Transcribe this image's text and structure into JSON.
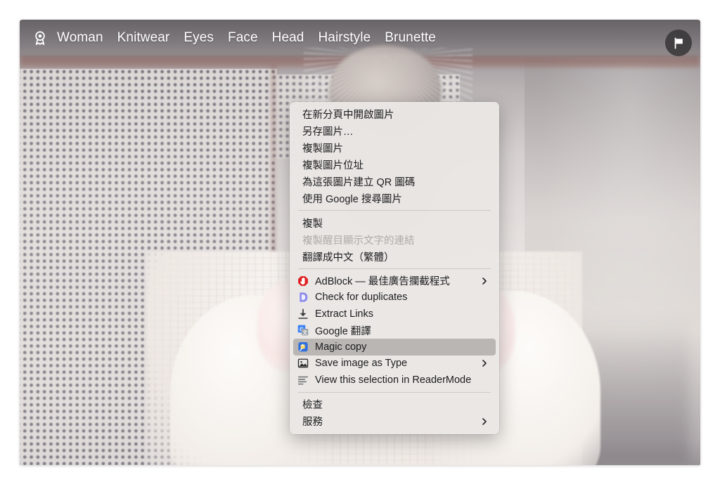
{
  "photo": {
    "alt_subject": "woman-in-white-knit-sweater"
  },
  "tagbar": {
    "award_icon": "award-ribbon-icon",
    "tags": [
      {
        "label": "Woman"
      },
      {
        "label": "Knitwear"
      },
      {
        "label": "Eyes"
      },
      {
        "label": "Face"
      },
      {
        "label": "Head"
      },
      {
        "label": "Hairstyle"
      },
      {
        "label": "Brunette"
      }
    ],
    "flag_button": {
      "icon": "flag-icon"
    }
  },
  "context_menu": {
    "groups": [
      {
        "id": "image-actions",
        "items": [
          {
            "label": "在新分頁中開啟圖片",
            "icon": null,
            "submenu": false,
            "disabled": false,
            "selected": false
          },
          {
            "label": "另存圖片…",
            "icon": null,
            "submenu": false,
            "disabled": false,
            "selected": false
          },
          {
            "label": "複製圖片",
            "icon": null,
            "submenu": false,
            "disabled": false,
            "selected": false
          },
          {
            "label": "複製圖片位址",
            "icon": null,
            "submenu": false,
            "disabled": false,
            "selected": false
          },
          {
            "label": "為這張圖片建立 QR 圖碼",
            "icon": null,
            "submenu": false,
            "disabled": false,
            "selected": false
          },
          {
            "label": "使用 Google 搜尋圖片",
            "icon": null,
            "submenu": false,
            "disabled": false,
            "selected": false
          }
        ]
      },
      {
        "id": "copy-translate",
        "items": [
          {
            "label": "複製",
            "icon": null,
            "submenu": false,
            "disabled": false,
            "selected": false
          },
          {
            "label": "複製醒目顯示文字的連結",
            "icon": null,
            "submenu": false,
            "disabled": true,
            "selected": false
          },
          {
            "label": "翻譯成中文（繁體）",
            "icon": null,
            "submenu": false,
            "disabled": false,
            "selected": false
          }
        ]
      },
      {
        "id": "extensions",
        "items": [
          {
            "label": "AdBlock — 最佳廣告攔截程式",
            "icon": "adblock-icon",
            "submenu": true,
            "disabled": false,
            "selected": false
          },
          {
            "label": "Check for duplicates",
            "icon": "duplicates-d-icon",
            "submenu": false,
            "disabled": false,
            "selected": false
          },
          {
            "label": "Extract Links",
            "icon": "download-arrow-icon",
            "submenu": false,
            "disabled": false,
            "selected": false
          },
          {
            "label": "Google 翻譯",
            "icon": "google-translate-icon",
            "submenu": false,
            "disabled": false,
            "selected": false
          },
          {
            "label": "Magic copy",
            "icon": "magic-copy-icon",
            "submenu": false,
            "disabled": false,
            "selected": true
          },
          {
            "label": "Save image as Type",
            "icon": "image-file-icon",
            "submenu": true,
            "disabled": false,
            "selected": false
          },
          {
            "label": "View this selection in ReaderMode",
            "icon": "reader-mode-icon",
            "submenu": false,
            "disabled": false,
            "selected": false
          }
        ]
      },
      {
        "id": "system",
        "items": [
          {
            "label": "檢查",
            "icon": null,
            "submenu": false,
            "disabled": false,
            "selected": false
          },
          {
            "label": "服務",
            "icon": null,
            "submenu": true,
            "disabled": false,
            "selected": false
          }
        ]
      }
    ]
  },
  "colors": {
    "menu_background": "#e9e6e4",
    "menu_text": "#1c1c1e",
    "menu_disabled_text": "#aeaaa8",
    "menu_selected_background": "#b9b6b4",
    "tag_text": "#ffffff",
    "flag_button_background": "#383638",
    "adblock_red": "#e02020",
    "duplicates_purple": "#8a8af0",
    "google_blue": "#4285f4",
    "magic_blue": "#2f6fe0",
    "page_background": "#ffffff"
  }
}
